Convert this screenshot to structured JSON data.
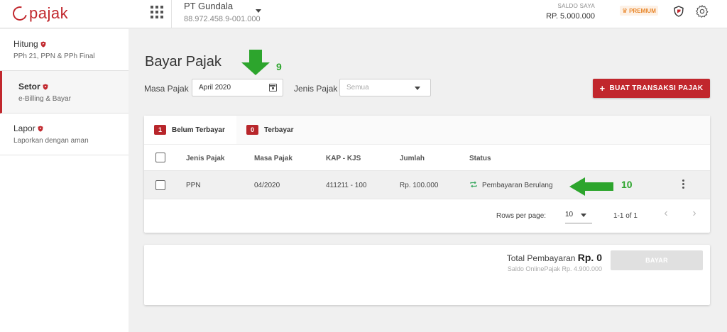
{
  "header": {
    "logo_text": "pajak",
    "company_name": "PT Gundala",
    "company_npwp": "88.972.458.9-001.000",
    "saldo_label": "SALDO SAYA",
    "saldo_value": "RP. 5.000.000",
    "premium_label": "PREMIUM",
    "accent_color": "#c1272d"
  },
  "sidebar": {
    "items": [
      {
        "title": "Hitung",
        "subtitle": "PPh 21, PPN & PPh Final",
        "active": false
      },
      {
        "title": "Setor",
        "subtitle": "e-Billing & Bayar",
        "active": true
      },
      {
        "title": "Lapor",
        "subtitle": "Laporkan dengan aman",
        "active": false
      }
    ]
  },
  "main": {
    "page_title": "Bayar Pajak",
    "annotation_9": "9",
    "annotation_10": "10",
    "masa_pajak_label": "Masa Pajak",
    "masa_pajak_value": "April 2020",
    "jenis_pajak_label": "Jenis Pajak",
    "jenis_pajak_placeholder": "Semua",
    "buat_button": "BUAT TRANSAKSI PAJAK"
  },
  "tabs": [
    {
      "count": "1",
      "label": "Belum Terbayar",
      "active": true
    },
    {
      "count": "0",
      "label": "Terbayar",
      "active": false
    }
  ],
  "table": {
    "columns": [
      "Jenis Pajak",
      "Masa Pajak",
      "KAP - KJS",
      "Jumlah",
      "Status"
    ],
    "rows": [
      {
        "jenis_pajak": "PPN",
        "masa_pajak": "04/2020",
        "kap_kjs": "411211 - 100",
        "jumlah": "Rp. 100.000",
        "status": "Pembayaran Berulang"
      }
    ]
  },
  "pager": {
    "rows_per_page_label": "Rows per page:",
    "rows_per_page_value": "10",
    "range": "1-1 of 1"
  },
  "total": {
    "label": "Total Pembayaran",
    "value": "Rp. 0",
    "saldo_online": "Saldo OnlinePajak Rp. 4.900.000",
    "bayar_button": "BAYAR"
  }
}
